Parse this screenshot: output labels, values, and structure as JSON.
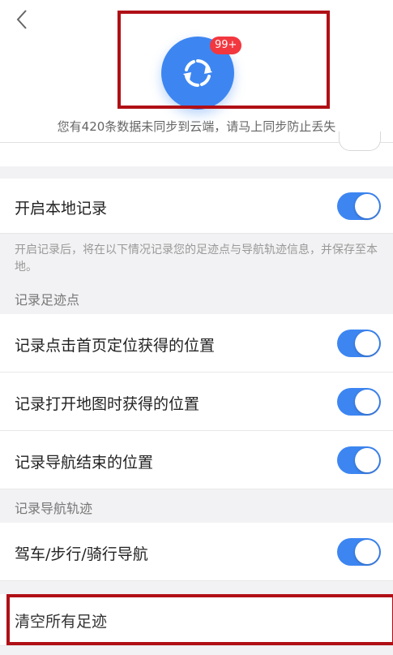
{
  "sync": {
    "badge": "99+",
    "tip": "您有420条数据未同步到云端，请马上同步防止丢失"
  },
  "local_record": {
    "label": "开启本地记录",
    "enabled": true,
    "note": "开启记录后，将在以下情况记录您的足迹点与导航轨迹信息，并保存至本地。"
  },
  "footprint_section": {
    "title": "记录足迹点",
    "items": [
      {
        "label": "记录点击首页定位获得的位置",
        "enabled": true
      },
      {
        "label": "记录打开地图时获得的位置",
        "enabled": true
      },
      {
        "label": "记录导航结束的位置",
        "enabled": true
      }
    ]
  },
  "track_section": {
    "title": "记录导航轨迹",
    "items": [
      {
        "label": "驾车/步行/骑行导航",
        "enabled": true
      }
    ]
  },
  "clear": {
    "label": "清空所有足迹"
  },
  "colors": {
    "accent": "#3d86f2",
    "badge": "#f2373f",
    "highlight": "#b00f16"
  }
}
